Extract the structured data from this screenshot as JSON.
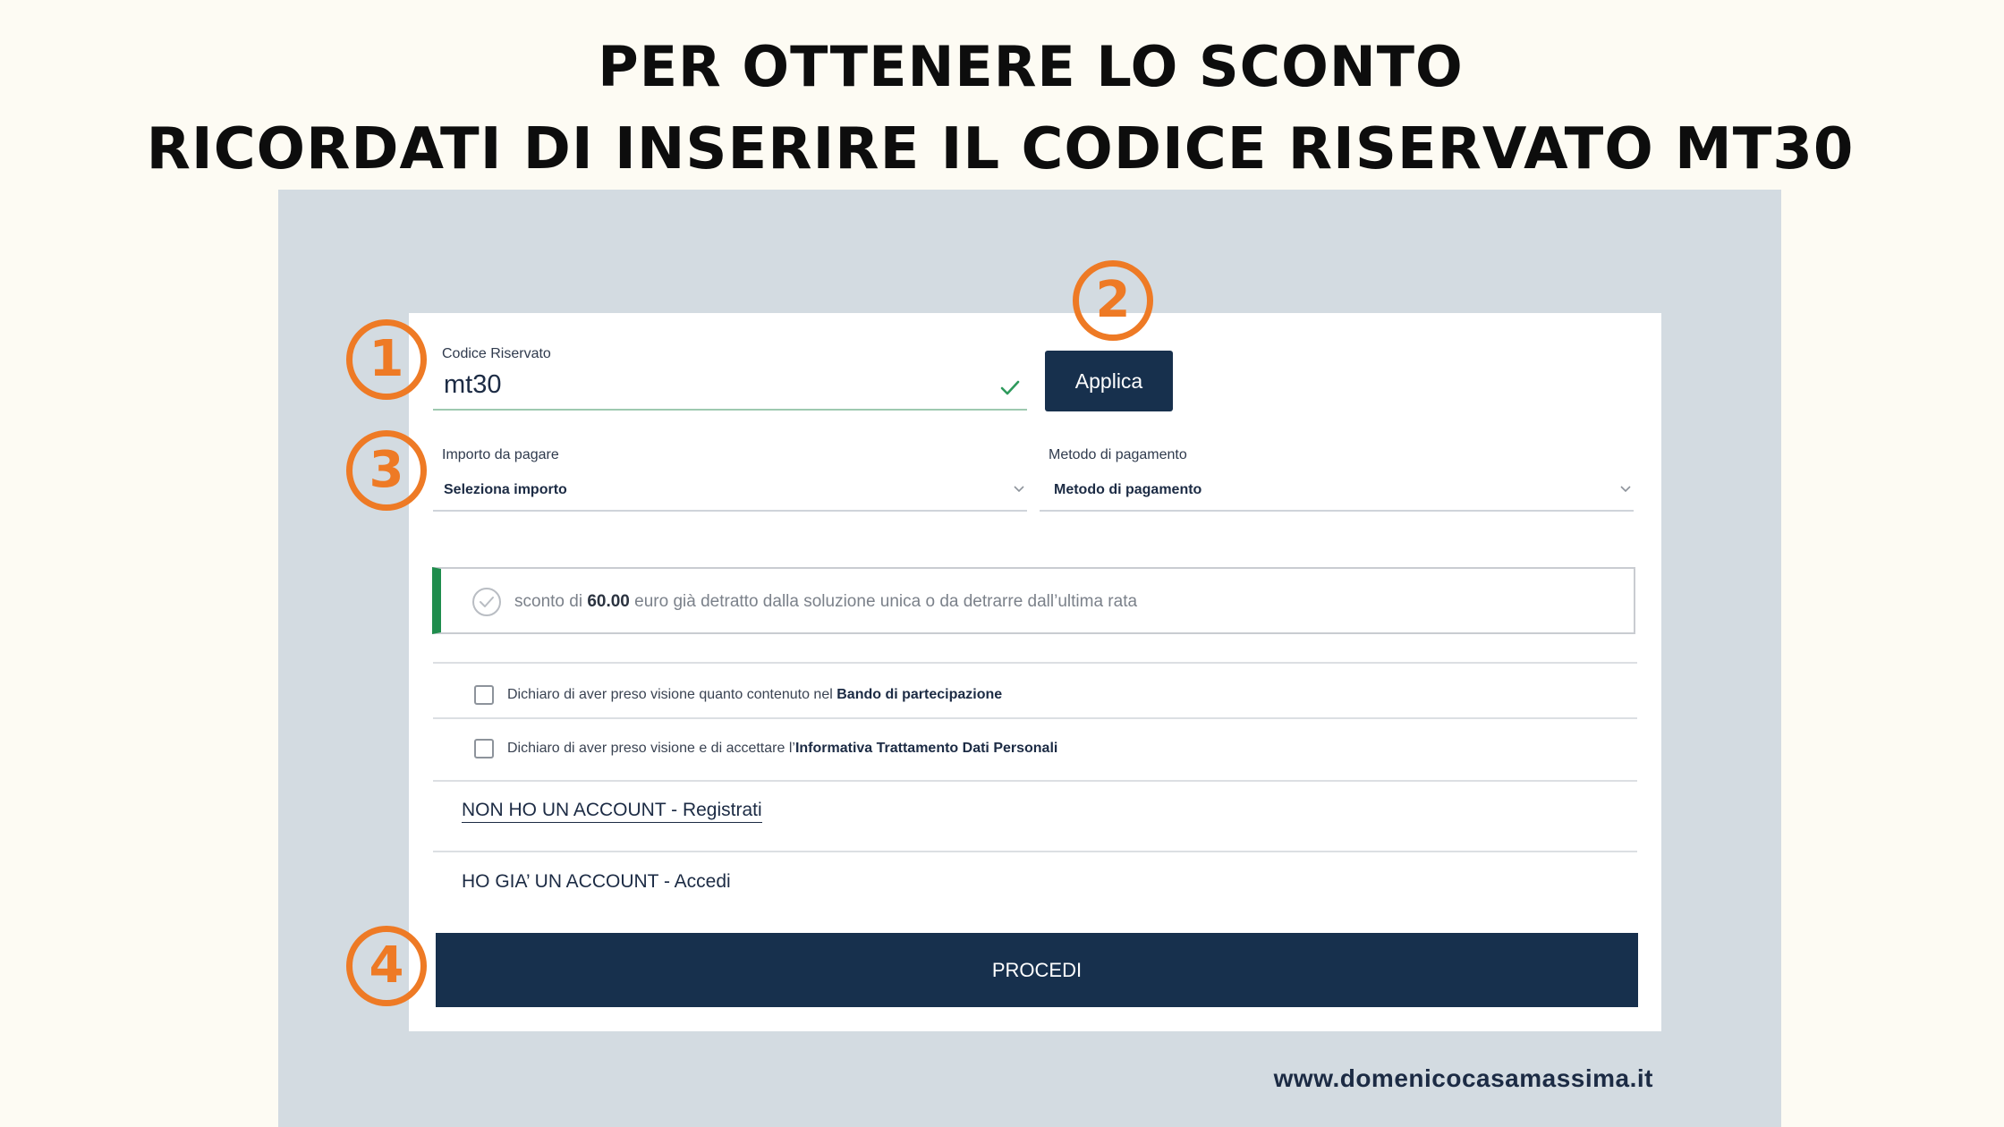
{
  "headline": {
    "line1": "PER OTTENERE LO SCONTO",
    "line2": "RICORDATI DI INSERIRE IL CODICE RISERVATO MT30"
  },
  "steps": [
    "1",
    "2",
    "3",
    "4"
  ],
  "form": {
    "code_label": "Codice Riservato",
    "code_value": "mt30",
    "apply_label": "Applica",
    "amount_label": "Importo da pagare",
    "amount_value": "Seleziona importo",
    "payment_label": "Metodo di pagamento",
    "payment_value": "Metodo di pagamento"
  },
  "discount": {
    "prefix": "sconto di",
    "amount": "60.00",
    "suffix": "euro già detratto dalla soluzione unica o da detrarre dall’ultima rata"
  },
  "checkboxes": [
    {
      "text": "Dichiaro di aver preso visione quanto contenuto nel",
      "link": "Bando di partecipazione"
    },
    {
      "text": "Dichiaro di aver preso visione e di accettare l’",
      "link": "Informativa Trattamento Dati Personali"
    }
  ],
  "account": {
    "register": "NON HO UN ACCOUNT - Registrati",
    "login": "HO GIA’ UN ACCOUNT - Accedi"
  },
  "proceed_label": "PROCEDI",
  "website": "www.domenicocasamassima.it",
  "colors": {
    "accent_orange": "#ee7a25",
    "navy": "#17304d",
    "success_green": "#1f8d4d"
  }
}
